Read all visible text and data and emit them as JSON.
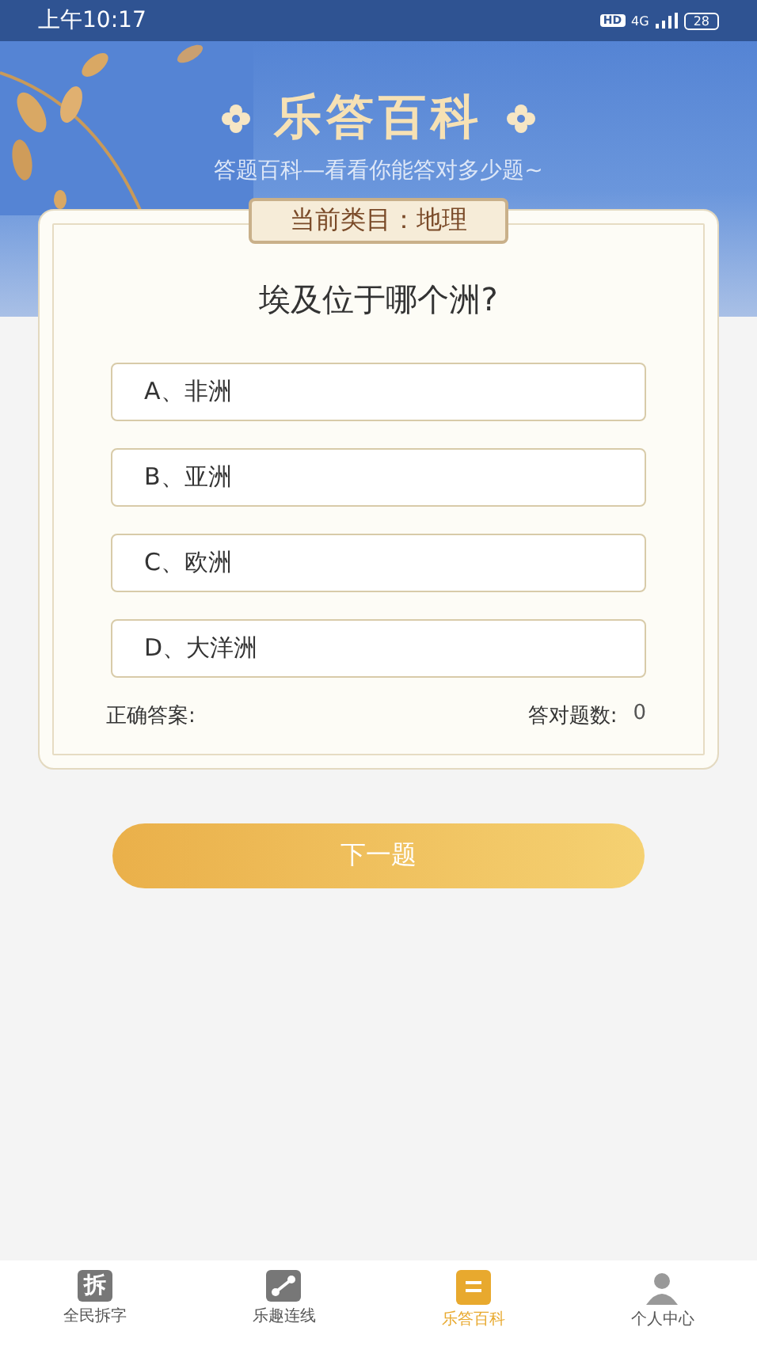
{
  "status_bar": {
    "time": "上午10:17",
    "hd": "HD",
    "network": "4G",
    "battery": "28"
  },
  "header": {
    "title": "乐答百科",
    "subtitle": "答题百科—看看你能答对多少题~"
  },
  "quiz": {
    "category": "当前类目：地理",
    "question": "埃及位于哪个洲?",
    "options": [
      {
        "label": "A、非洲",
        "selected": false
      },
      {
        "label": "B、亚洲",
        "selected": false
      },
      {
        "label": "C、欧洲",
        "selected": false
      },
      {
        "label": "D、大洋洲",
        "selected": false
      }
    ],
    "answer_label": "正确答案:",
    "score_label": "答对题数:",
    "score": "0"
  },
  "next_button": "下一题",
  "tabs": [
    {
      "label": "全民拆字",
      "kind": "char",
      "icon_text": "拆",
      "selected": false
    },
    {
      "label": "乐趣连线",
      "kind": "link",
      "selected": false
    },
    {
      "label": "乐答百科",
      "kind": "book",
      "selected": true
    },
    {
      "label": "个人中心",
      "kind": "person",
      "selected": false
    }
  ]
}
